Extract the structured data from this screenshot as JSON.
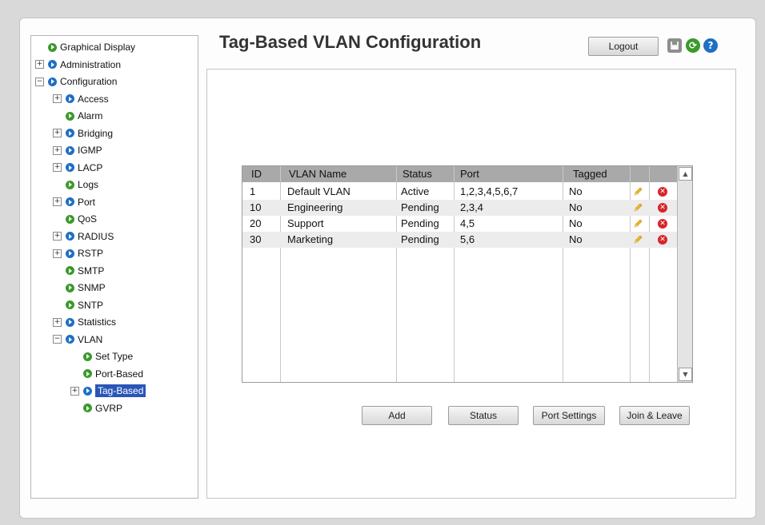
{
  "page": {
    "title": "Tag-Based VLAN Configuration"
  },
  "header": {
    "logout_label": "Logout",
    "save_icon": "disk-icon",
    "refresh_icon": "refresh-icon",
    "help_icon": "help-icon"
  },
  "tree": [
    {
      "label": "Graphical Display",
      "expander": "",
      "bullet": "green"
    },
    {
      "label": "Administration",
      "expander": "+",
      "bullet": "blue"
    },
    {
      "label": "Configuration",
      "expander": "−",
      "bullet": "blue"
    },
    {
      "label": "Access",
      "expander": "+",
      "bullet": "blue"
    },
    {
      "label": "Alarm",
      "expander": "",
      "bullet": "green"
    },
    {
      "label": "Bridging",
      "expander": "+",
      "bullet": "blue"
    },
    {
      "label": "IGMP",
      "expander": "+",
      "bullet": "blue"
    },
    {
      "label": "LACP",
      "expander": "+",
      "bullet": "blue"
    },
    {
      "label": "Logs",
      "expander": "",
      "bullet": "green"
    },
    {
      "label": "Port",
      "expander": "+",
      "bullet": "blue"
    },
    {
      "label": "QoS",
      "expander": "",
      "bullet": "green"
    },
    {
      "label": "RADIUS",
      "expander": "+",
      "bullet": "blue"
    },
    {
      "label": "RSTP",
      "expander": "+",
      "bullet": "blue"
    },
    {
      "label": "SMTP",
      "expander": "",
      "bullet": "green"
    },
    {
      "label": "SNMP",
      "expander": "",
      "bullet": "green"
    },
    {
      "label": "SNTP",
      "expander": "",
      "bullet": "green"
    },
    {
      "label": "Statistics",
      "expander": "+",
      "bullet": "blue"
    },
    {
      "label": "VLAN",
      "expander": "−",
      "bullet": "blue"
    },
    {
      "label": "Set Type",
      "expander": "",
      "bullet": "green"
    },
    {
      "label": "Port-Based",
      "expander": "",
      "bullet": "green"
    },
    {
      "label": "Tag-Based",
      "expander": "+",
      "bullet": "blue",
      "selected": true
    },
    {
      "label": "GVRP",
      "expander": "",
      "bullet": "green"
    }
  ],
  "table": {
    "headers": [
      "ID",
      "VLAN Name",
      "Status",
      "Port",
      "Tagged"
    ],
    "rows": [
      {
        "id": "1",
        "name": "Default VLAN",
        "status": "Active",
        "port": "1,2,3,4,5,6,7",
        "tagged": "No"
      },
      {
        "id": "10",
        "name": "Engineering",
        "status": "Pending",
        "port": "2,3,4",
        "tagged": "No"
      },
      {
        "id": "20",
        "name": "Support",
        "status": "Pending",
        "port": "4,5",
        "tagged": "No"
      },
      {
        "id": "30",
        "name": "Marketing",
        "status": "Pending",
        "port": "5,6",
        "tagged": "No"
      }
    ]
  },
  "buttons": {
    "add": "Add",
    "status": "Status",
    "port_settings": "Port Settings",
    "join_leave": "Join & Leave"
  },
  "colors": {
    "selected": "#2a55b8",
    "header_bg": "#a9a9a9",
    "delete": "#d8252a",
    "edit": "#f2c21d"
  }
}
